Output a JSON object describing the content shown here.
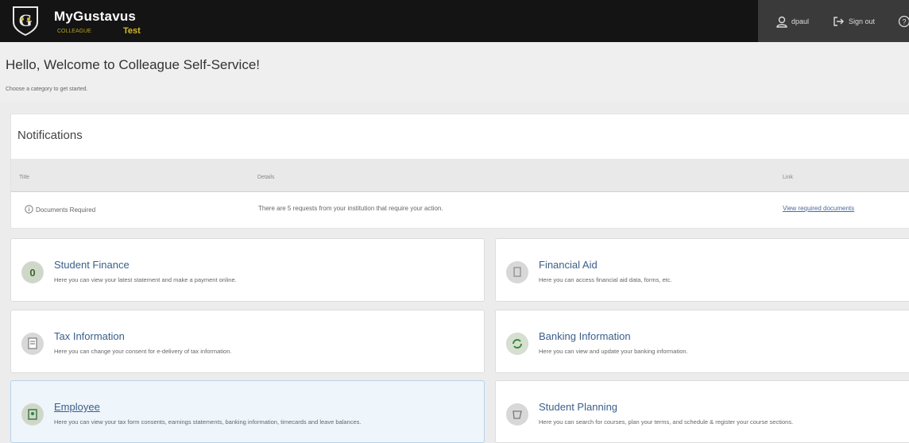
{
  "header": {
    "brand": "MyGustavus",
    "brand_subtitle": "COLLEAGUE",
    "env_label": "Test",
    "username": "dpaul",
    "signout_label": "Sign out"
  },
  "welcome": {
    "title": "Hello, Welcome to Colleague Self-Service!",
    "subtitle": "Choose a category to get started."
  },
  "notifications": {
    "title": "Notifications",
    "columns": [
      "Title",
      "Details",
      "Link"
    ],
    "rows": [
      {
        "title": "Documents Required",
        "details": "There are 5 requests from your institution that require your action.",
        "link": "View required documents"
      }
    ]
  },
  "tiles": [
    {
      "title": "Student Finance",
      "description": "Here you can view your latest statement and make a payment online.",
      "icon": "dollar-icon"
    },
    {
      "title": "Financial Aid",
      "description": "Here you can access financial aid data, forms, etc.",
      "icon": "document-icon"
    },
    {
      "title": "Tax Information",
      "description": "Here you can change your consent for e-delivery of tax information.",
      "icon": "tax-form-icon"
    },
    {
      "title": "Banking Information",
      "description": "Here you can view and update your banking information.",
      "icon": "bank-refresh-icon"
    },
    {
      "title": "Employee",
      "description": "Here you can view your tax form consents, earnings statements, banking information, timecards and leave balances.",
      "icon": "employee-badge-icon"
    },
    {
      "title": "Student Planning",
      "description": "Here you can search for courses, plan your terms, and schedule & register your course sections.",
      "icon": "planning-icon"
    }
  ],
  "colors": {
    "topbar": "#141414",
    "accent_gold": "#d4b82a",
    "link_blue": "#3a5f8a",
    "active_tile": "#eef5fb"
  }
}
